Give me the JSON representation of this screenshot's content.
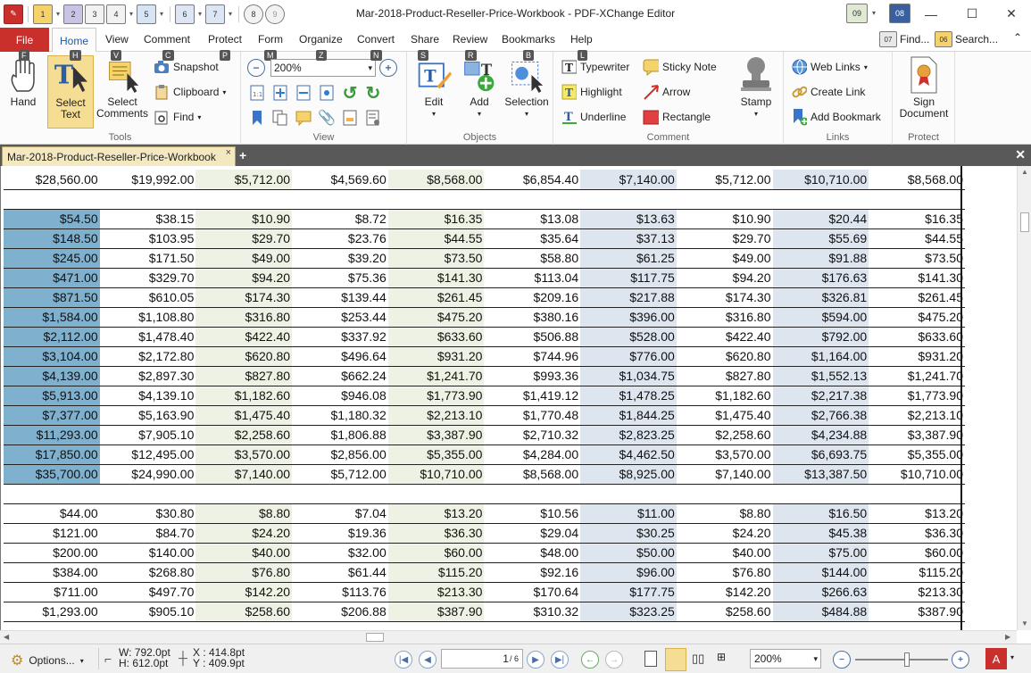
{
  "window": {
    "title": "Mar-2018-Product-Reseller-Price-Workbook - PDF-XChange Editor",
    "qat_keytips": [
      "1",
      "2",
      "3",
      "4",
      "5",
      "6",
      "7",
      "8",
      "9"
    ],
    "right_keytips": [
      "09",
      "08"
    ]
  },
  "menu": {
    "file": "File",
    "tabs": [
      "Home",
      "View",
      "Comment",
      "Protect",
      "Form",
      "Organize",
      "Convert",
      "Share",
      "Review",
      "Bookmarks",
      "Help"
    ],
    "find_label": "Find...",
    "find_keytip": "07",
    "search_label": "Search...",
    "search_keytip": "06"
  },
  "ribbon": {
    "tools": {
      "label": "Tools",
      "hand": "Hand",
      "select_text": "Select Text",
      "select_comments": "Select Comments",
      "snapshot": "Snapshot",
      "clipboard": "Clipboard",
      "find": "Find",
      "keytips": {
        "hand": "F",
        "select_text": "H",
        "select_comments": "V",
        "snapshot": "C",
        "extra": "P"
      }
    },
    "view": {
      "label": "View",
      "zoom_value": "200%",
      "keytips": {
        "zoom_out": "M",
        "zoom": "Z",
        "zoom_in": "N"
      }
    },
    "objects": {
      "label": "Objects",
      "edit": "Edit",
      "add": "Add",
      "selection": "Selection",
      "keytips": {
        "edit": "S",
        "add": "R",
        "selection": "B"
      }
    },
    "comment": {
      "label": "Comment",
      "typewriter": "Typewriter",
      "sticky_note": "Sticky Note",
      "highlight": "Highlight",
      "arrow": "Arrow",
      "underline": "Underline",
      "rectangle": "Rectangle",
      "stamp": "Stamp",
      "keytips": {
        "typewriter": "L"
      }
    },
    "links": {
      "label": "Links",
      "web_links": "Web Links",
      "create_link": "Create Link",
      "add_bookmark": "Add Bookmark"
    },
    "protect": {
      "label": "Protect",
      "sign_document": "Sign Document"
    }
  },
  "document_tab": {
    "title": "Mar-2018-Product-Reseller-Price-Workbook",
    "close": "×",
    "add": "+"
  },
  "table": {
    "rows": [
      [
        "$28,560.00",
        "$19,992.00",
        "$5,712.00",
        "$4,569.60",
        "$8,568.00",
        "$6,854.40",
        "$7,140.00",
        "$5,712.00",
        "$10,710.00",
        "$8,568.00"
      ],
      [],
      [
        "$54.50",
        "$38.15",
        "$10.90",
        "$8.72",
        "$16.35",
        "$13.08",
        "$13.63",
        "$10.90",
        "$20.44",
        "$16.35"
      ],
      [
        "$148.50",
        "$103.95",
        "$29.70",
        "$23.76",
        "$44.55",
        "$35.64",
        "$37.13",
        "$29.70",
        "$55.69",
        "$44.55"
      ],
      [
        "$245.00",
        "$171.50",
        "$49.00",
        "$39.20",
        "$73.50",
        "$58.80",
        "$61.25",
        "$49.00",
        "$91.88",
        "$73.50"
      ],
      [
        "$471.00",
        "$329.70",
        "$94.20",
        "$75.36",
        "$141.30",
        "$113.04",
        "$117.75",
        "$94.20",
        "$176.63",
        "$141.30"
      ],
      [
        "$871.50",
        "$610.05",
        "$174.30",
        "$139.44",
        "$261.45",
        "$209.16",
        "$217.88",
        "$174.30",
        "$326.81",
        "$261.45"
      ],
      [
        "$1,584.00",
        "$1,108.80",
        "$316.80",
        "$253.44",
        "$475.20",
        "$380.16",
        "$396.00",
        "$316.80",
        "$594.00",
        "$475.20"
      ],
      [
        "$2,112.00",
        "$1,478.40",
        "$422.40",
        "$337.92",
        "$633.60",
        "$506.88",
        "$528.00",
        "$422.40",
        "$792.00",
        "$633.60"
      ],
      [
        "$3,104.00",
        "$2,172.80",
        "$620.80",
        "$496.64",
        "$931.20",
        "$744.96",
        "$776.00",
        "$620.80",
        "$1,164.00",
        "$931.20"
      ],
      [
        "$4,139.00",
        "$2,897.30",
        "$827.80",
        "$662.24",
        "$1,241.70",
        "$993.36",
        "$1,034.75",
        "$827.80",
        "$1,552.13",
        "$1,241.70"
      ],
      [
        "$5,913.00",
        "$4,139.10",
        "$1,182.60",
        "$946.08",
        "$1,773.90",
        "$1,419.12",
        "$1,478.25",
        "$1,182.60",
        "$2,217.38",
        "$1,773.90"
      ],
      [
        "$7,377.00",
        "$5,163.90",
        "$1,475.40",
        "$1,180.32",
        "$2,213.10",
        "$1,770.48",
        "$1,844.25",
        "$1,475.40",
        "$2,766.38",
        "$2,213.10"
      ],
      [
        "$11,293.00",
        "$7,905.10",
        "$2,258.60",
        "$1,806.88",
        "$3,387.90",
        "$2,710.32",
        "$2,823.25",
        "$2,258.60",
        "$4,234.88",
        "$3,387.90"
      ],
      [
        "$17,850.00",
        "$12,495.00",
        "$3,570.00",
        "$2,856.00",
        "$5,355.00",
        "$4,284.00",
        "$4,462.50",
        "$3,570.00",
        "$6,693.75",
        "$5,355.00"
      ],
      [
        "$35,700.00",
        "$24,990.00",
        "$7,140.00",
        "$5,712.00",
        "$10,710.00",
        "$8,568.00",
        "$8,925.00",
        "$7,140.00",
        "$13,387.50",
        "$10,710.00"
      ],
      [],
      [
        "$44.00",
        "$30.80",
        "$8.80",
        "$7.04",
        "$13.20",
        "$10.56",
        "$11.00",
        "$8.80",
        "$16.50",
        "$13.20"
      ],
      [
        "$121.00",
        "$84.70",
        "$24.20",
        "$19.36",
        "$36.30",
        "$29.04",
        "$30.25",
        "$24.20",
        "$45.38",
        "$36.30"
      ],
      [
        "$200.00",
        "$140.00",
        "$40.00",
        "$32.00",
        "$60.00",
        "$48.00",
        "$50.00",
        "$40.00",
        "$75.00",
        "$60.00"
      ],
      [
        "$384.00",
        "$268.80",
        "$76.80",
        "$61.44",
        "$115.20",
        "$92.16",
        "$96.00",
        "$76.80",
        "$144.00",
        "$115.20"
      ],
      [
        "$711.00",
        "$497.70",
        "$142.20",
        "$113.76",
        "$213.30",
        "$170.64",
        "$177.75",
        "$142.20",
        "$266.63",
        "$213.30"
      ],
      [
        "$1,293.00",
        "$905.10",
        "$258.60",
        "$206.88",
        "$387.90",
        "$310.32",
        "$323.25",
        "$258.60",
        "$484.88",
        "$387.90"
      ]
    ],
    "highlighted_rows_first_col": [
      2,
      3,
      4,
      5,
      6,
      7,
      8,
      9,
      10,
      11,
      12,
      13,
      14,
      15
    ]
  },
  "status": {
    "options": "Options...",
    "width": "W: 792.0pt",
    "height": "H: 612.0pt",
    "x": "X : 414.8pt",
    "y": "Y : 409.9pt",
    "page_current": "1",
    "page_total": "/ 6",
    "zoom": "200%"
  },
  "colors": {
    "file_tab": "#c9302c",
    "highlight_blue": "#7fb1cf",
    "col_green": "#eef2e4",
    "col_blue": "#dde5ef",
    "doc_tab": "#f3e8c0"
  }
}
